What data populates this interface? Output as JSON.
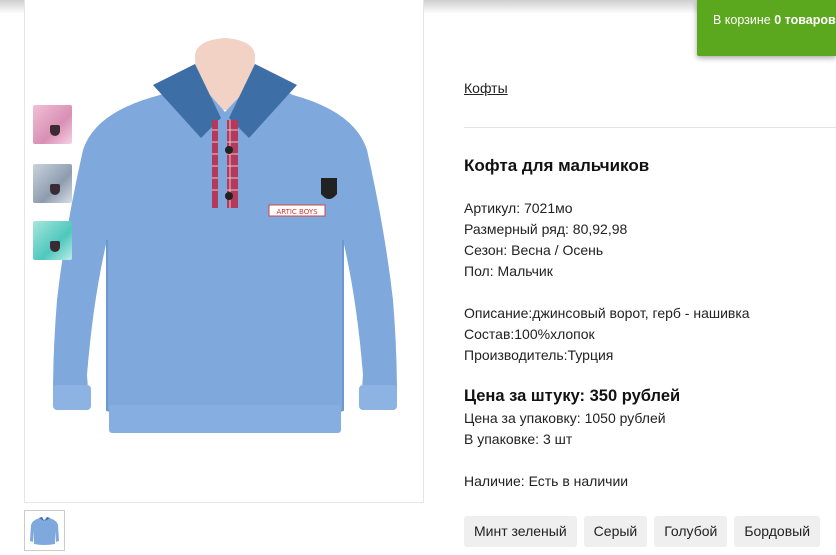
{
  "cart": {
    "prefix": "В корзине ",
    "count_text": "0 товаров"
  },
  "breadcrumb": {
    "category": "Кофты"
  },
  "product": {
    "title": "Кофта для мальчиков",
    "article": "Артикул: 7021мо",
    "sizes": "Размерный ряд: 80,92,98",
    "season": "Сезон: Весна / Осень",
    "gender": "Пол: Мальчик",
    "description": "Описание:джинсовый ворот, герб - нашивка",
    "composition": "Состав:100%хлопок",
    "manufacturer": "Производитель:Турция",
    "price_unit": "Цена за штуку: 350 рублей",
    "price_pack": "Цена за упаковку: 1050 рублей",
    "pack_qty": "В упаковке: 3 шт",
    "availability": "Наличие: Есть в наличии",
    "patch_text": "ARTIC BOYS"
  },
  "variants": [
    "Минт зеленый",
    "Серый",
    "Голубой",
    "Бордовый"
  ],
  "colors": {
    "cart_bg": "#5ba71e",
    "sweater": "#7fa8dd",
    "collar_denim": "#3d6ea6",
    "placket_check": "#b33a5a"
  }
}
